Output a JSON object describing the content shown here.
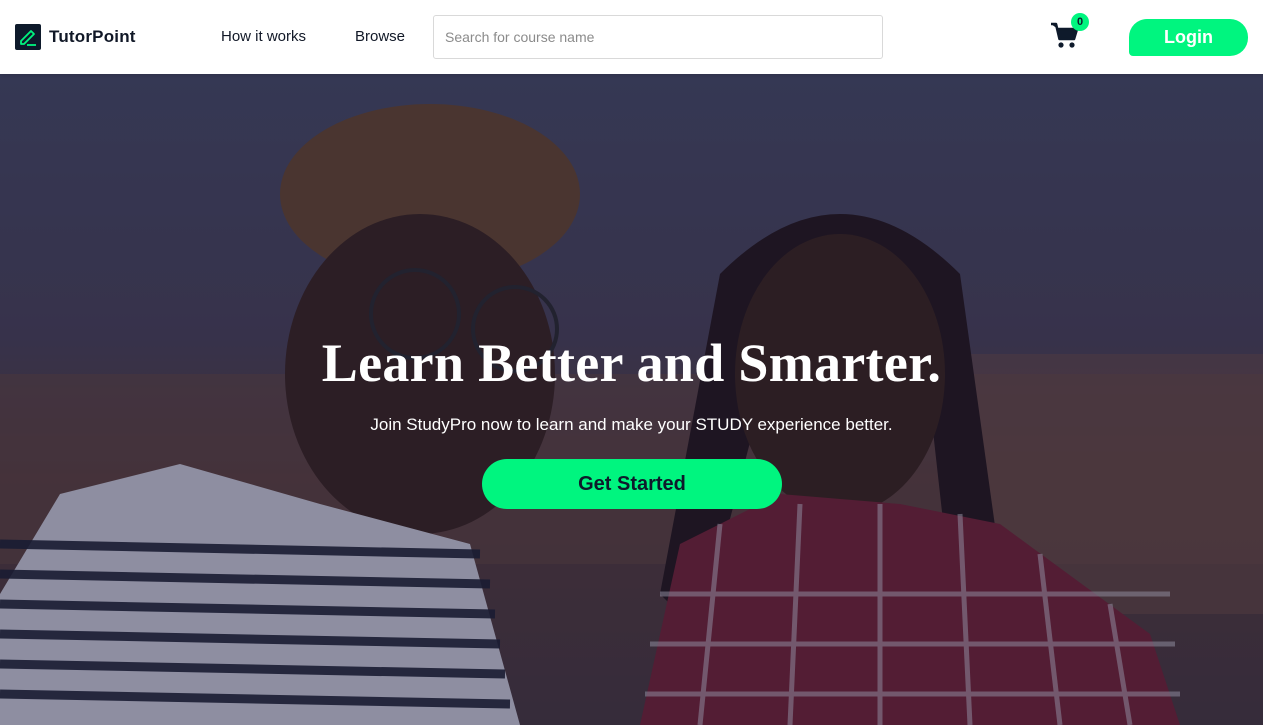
{
  "header": {
    "brand": "TutorPoint",
    "nav": {
      "how_it_works": "How it works",
      "browse": "Browse"
    },
    "search": {
      "placeholder": "Search for course name",
      "value": ""
    },
    "cart": {
      "icon": "cart-icon",
      "count": "0"
    },
    "login_label": "Login"
  },
  "hero": {
    "title": "Learn Better and Smarter.",
    "subtitle": "Join StudyPro now to learn and make your STUDY experience better.",
    "cta_label": "Get Started"
  },
  "colors": {
    "accent": "#00f57f",
    "brand_dark": "#0e1a2b",
    "header_bg": "#ffffff",
    "hero_overlay": "#141637"
  }
}
